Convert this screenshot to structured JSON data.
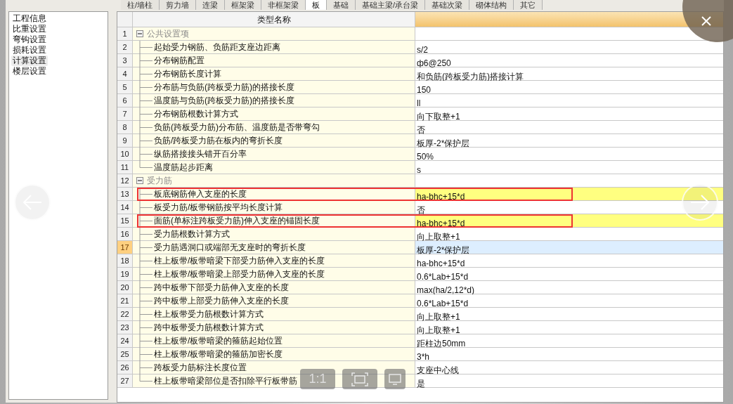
{
  "tabs": [
    {
      "label": "柱/墙柱",
      "selected": false
    },
    {
      "label": "剪力墙",
      "selected": false
    },
    {
      "label": "连梁",
      "selected": false
    },
    {
      "label": "框架梁",
      "selected": false
    },
    {
      "label": "非框架梁",
      "selected": false
    },
    {
      "label": "板",
      "selected": true
    },
    {
      "label": "基础",
      "selected": false
    },
    {
      "label": "基础主梁/承台梁",
      "selected": false
    },
    {
      "label": "基础次梁",
      "selected": false
    },
    {
      "label": "砌体结构",
      "selected": false
    },
    {
      "label": "其它",
      "selected": false
    }
  ],
  "sidebar": {
    "items": [
      {
        "label": "工程信息",
        "selected": false
      },
      {
        "label": "比重设置",
        "selected": false
      },
      {
        "label": "弯钩设置",
        "selected": false
      },
      {
        "label": "损耗设置",
        "selected": false
      },
      {
        "label": "计算设置",
        "selected": true
      },
      {
        "label": "楼层设置",
        "selected": false
      }
    ]
  },
  "table": {
    "column_header": "类型名称",
    "groups": [
      {
        "number": "1",
        "name": "公共设置项",
        "expanded": true,
        "children": [
          {
            "number": "2",
            "name": "起始受力钢筋、负筋距支座边距离",
            "value": "s/2",
            "marked": false,
            "outlined": false,
            "selected": false
          },
          {
            "number": "3",
            "name": "分布钢筋配置",
            "value": "ф6@250",
            "marked": false,
            "outlined": false,
            "selected": false
          },
          {
            "number": "4",
            "name": "分布钢筋长度计算",
            "value": "和负筋(跨板受力筋)搭接计算",
            "marked": false,
            "outlined": false,
            "selected": false
          },
          {
            "number": "5",
            "name": "分布筋与负筋(跨板受力筋)的搭接长度",
            "value": "150",
            "marked": false,
            "outlined": false,
            "selected": false
          },
          {
            "number": "6",
            "name": "温度筋与负筋(跨板受力筋)的搭接长度",
            "value": "ll",
            "marked": false,
            "outlined": false,
            "selected": false
          },
          {
            "number": "7",
            "name": "分布钢筋根数计算方式",
            "value": "向下取整+1",
            "marked": false,
            "outlined": false,
            "selected": false
          },
          {
            "number": "8",
            "name": "负筋(跨板受力筋)分布筋、温度筋是否带弯勾",
            "value": "否",
            "marked": false,
            "outlined": false,
            "selected": false
          },
          {
            "number": "9",
            "name": "负筋/跨板受力筋在板内的弯折长度",
            "value": "板厚-2*保护层",
            "marked": false,
            "outlined": false,
            "selected": false
          },
          {
            "number": "10",
            "name": "纵筋搭接接头错开百分率",
            "value": "50%",
            "marked": false,
            "outlined": false,
            "selected": false
          },
          {
            "number": "11",
            "name": "温度筋起步距离",
            "value": "s",
            "marked": false,
            "outlined": false,
            "selected": false
          }
        ]
      },
      {
        "number": "12",
        "name": "受力筋",
        "expanded": true,
        "children": [
          {
            "number": "13",
            "name": "板底钢筋伸入支座的长度",
            "value": "ha-bhc+15*d",
            "marked": true,
            "outlined": true,
            "selected": false
          },
          {
            "number": "14",
            "name": "板受力筋/板带钢筋按平均长度计算",
            "value": "否",
            "marked": false,
            "outlined": false,
            "selected": false
          },
          {
            "number": "15",
            "name": "面筋(单标注跨板受力筋)伸入支座的锚固长度",
            "value": "ha-bhc+15*d",
            "marked": true,
            "outlined": true,
            "selected": false
          },
          {
            "number": "16",
            "name": "受力筋根数计算方式",
            "value": "向上取整+1",
            "marked": false,
            "outlined": false,
            "selected": false
          },
          {
            "number": "17",
            "name": "受力筋遇洞口或端部无支座时的弯折长度",
            "value": "板厚-2*保护层",
            "marked": false,
            "outlined": false,
            "selected": true
          },
          {
            "number": "18",
            "name": "柱上板带/板带暗梁下部受力筋伸入支座的长度",
            "value": "ha-bhc+15*d",
            "marked": false,
            "outlined": false,
            "selected": false
          },
          {
            "number": "19",
            "name": "柱上板带/板带暗梁上部受力筋伸入支座的长度",
            "value": "0.6*Lab+15*d",
            "marked": false,
            "outlined": false,
            "selected": false
          },
          {
            "number": "20",
            "name": "跨中板带下部受力筋伸入支座的长度",
            "value": "max(ha/2,12*d)",
            "marked": false,
            "outlined": false,
            "selected": false
          },
          {
            "number": "21",
            "name": "跨中板带上部受力筋伸入支座的长度",
            "value": "0.6*Lab+15*d",
            "marked": false,
            "outlined": false,
            "selected": false
          },
          {
            "number": "22",
            "name": "柱上板带受力筋根数计算方式",
            "value": "向上取整+1",
            "marked": false,
            "outlined": false,
            "selected": false
          },
          {
            "number": "23",
            "name": "跨中板带受力筋根数计算方式",
            "value": "向上取整+1",
            "marked": false,
            "outlined": false,
            "selected": false
          },
          {
            "number": "24",
            "name": "柱上板带/板带暗梁的箍筋起始位置",
            "value": "距柱边50mm",
            "marked": false,
            "outlined": false,
            "selected": false
          },
          {
            "number": "25",
            "name": "柱上板带/板带暗梁的箍筋加密长度",
            "value": "3*h",
            "marked": false,
            "outlined": false,
            "selected": false
          },
          {
            "number": "26",
            "name": "跨板受力筋标注长度位置",
            "value": "支座中心线",
            "marked": false,
            "outlined": false,
            "selected": false
          },
          {
            "number": "27",
            "name": "柱上板带暗梁部位是否扣除平行板带筋",
            "value": "是",
            "marked": false,
            "outlined": false,
            "selected": false
          }
        ]
      }
    ]
  },
  "viewer": {
    "zoom_label": "1:1"
  }
}
